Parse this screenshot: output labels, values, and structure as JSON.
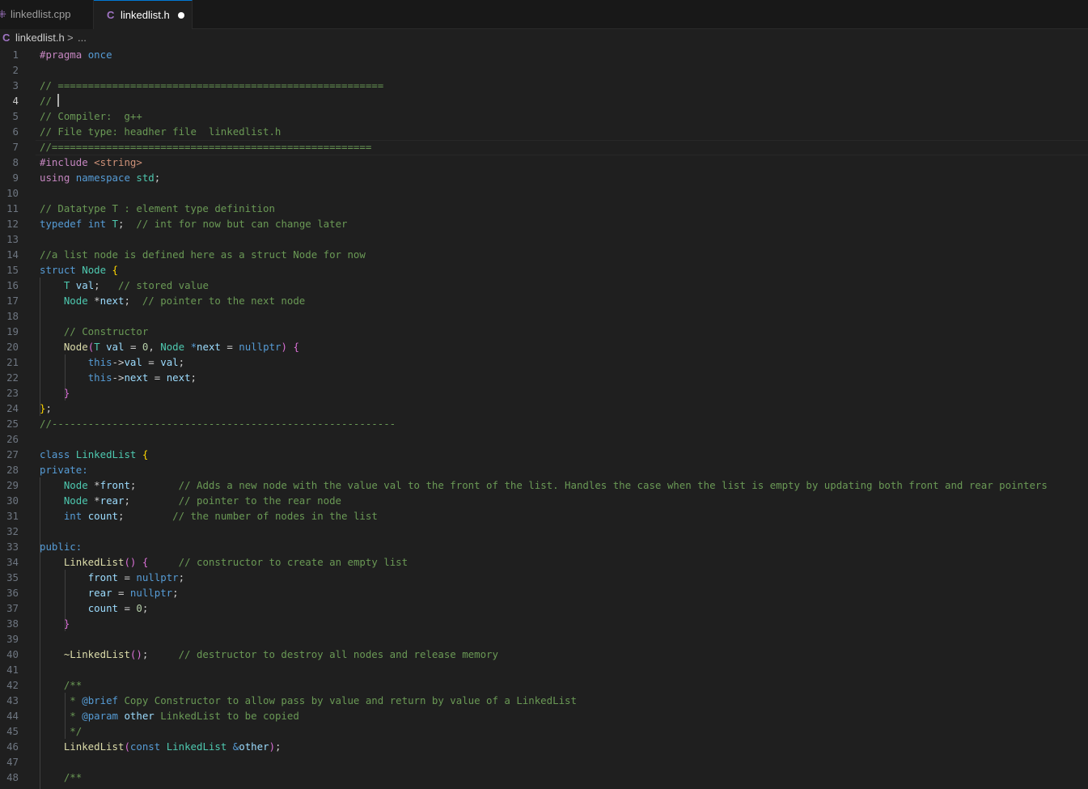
{
  "tabs": [
    {
      "label": "linkedlist.cpp",
      "icon": "cpp-file-icon",
      "active": false
    },
    {
      "label": "linkedlist.h",
      "icon": "c-header-file-icon",
      "active": true,
      "modified": true
    }
  ],
  "breadcrumb": {
    "icon": "C",
    "file": "linkedlist.h",
    "separator": ">",
    "more": "..."
  },
  "file_icon_letter": "C",
  "cursor_line": 4,
  "lines": [
    {
      "n": "1",
      "tokens": [
        [
          "#pragma",
          "t-ctl"
        ],
        [
          " ",
          ""
        ],
        [
          "once",
          "t-kw"
        ]
      ]
    },
    {
      "n": "2",
      "tokens": []
    },
    {
      "n": "3",
      "tokens": [
        [
          "// ======================================================",
          "t-c"
        ]
      ]
    },
    {
      "n": "4",
      "tokens": [
        [
          "// ",
          "t-c"
        ]
      ],
      "cursor": true
    },
    {
      "n": "5",
      "tokens": [
        [
          "// Compiler:  g++",
          "t-c"
        ]
      ]
    },
    {
      "n": "6",
      "tokens": [
        [
          "// File type: headher file  linkedlist.h",
          "t-c"
        ]
      ]
    },
    {
      "n": "7",
      "tokens": [
        [
          "//=====================================================",
          "t-c"
        ]
      ]
    },
    {
      "n": "8",
      "tokens": [
        [
          "#include",
          "t-ctl"
        ],
        [
          " ",
          ""
        ],
        [
          "<string>",
          "t-s"
        ]
      ]
    },
    {
      "n": "9",
      "tokens": [
        [
          "using",
          "t-ctl"
        ],
        [
          " ",
          ""
        ],
        [
          "namespace",
          "t-kw"
        ],
        [
          " ",
          ""
        ],
        [
          "std",
          "t-ty"
        ],
        [
          ";",
          ""
        ]
      ]
    },
    {
      "n": "10",
      "tokens": []
    },
    {
      "n": "11",
      "tokens": [
        [
          "// Datatype T : element type definition",
          "t-c"
        ]
      ]
    },
    {
      "n": "12",
      "tokens": [
        [
          "typedef",
          "t-kw"
        ],
        [
          " ",
          ""
        ],
        [
          "int",
          "t-kw"
        ],
        [
          " ",
          ""
        ],
        [
          "T",
          "t-ty"
        ],
        [
          ";  ",
          ""
        ],
        [
          "// int for now but can change later",
          "t-c"
        ]
      ]
    },
    {
      "n": "13",
      "tokens": []
    },
    {
      "n": "14",
      "tokens": [
        [
          "//a list node is defined here as a struct Node for now",
          "t-c"
        ]
      ]
    },
    {
      "n": "15",
      "tokens": [
        [
          "struct",
          "t-kw"
        ],
        [
          " ",
          ""
        ],
        [
          "Node",
          "t-ty"
        ],
        [
          " ",
          ""
        ],
        [
          "{",
          "t-b1"
        ]
      ]
    },
    {
      "n": "16",
      "tokens": [
        [
          "    ",
          ""
        ],
        [
          "T",
          "t-ty"
        ],
        [
          " ",
          ""
        ],
        [
          "val",
          "t-v"
        ],
        [
          ";   ",
          ""
        ],
        [
          "// stored value",
          "t-c"
        ]
      ]
    },
    {
      "n": "17",
      "tokens": [
        [
          "    ",
          ""
        ],
        [
          "Node",
          "t-ty"
        ],
        [
          " *",
          ""
        ],
        [
          "next",
          "t-v"
        ],
        [
          ";  ",
          ""
        ],
        [
          "// pointer to the next node",
          "t-c"
        ]
      ]
    },
    {
      "n": "18",
      "tokens": []
    },
    {
      "n": "19",
      "tokens": [
        [
          "    ",
          ""
        ],
        [
          "// Constructor",
          "t-c"
        ]
      ]
    },
    {
      "n": "20",
      "tokens": [
        [
          "    ",
          ""
        ],
        [
          "Node",
          "t-fn"
        ],
        [
          "(",
          "t-b2"
        ],
        [
          "T",
          "t-ty"
        ],
        [
          " ",
          ""
        ],
        [
          "val",
          "t-v"
        ],
        [
          " = ",
          ""
        ],
        [
          "0",
          "t-n"
        ],
        [
          ", ",
          ""
        ],
        [
          "Node",
          "t-ty"
        ],
        [
          " ",
          ""
        ],
        [
          "*",
          "t-kw"
        ],
        [
          "next",
          "t-v"
        ],
        [
          " = ",
          ""
        ],
        [
          "nullptr",
          "t-kw"
        ],
        [
          ")",
          "t-b2"
        ],
        [
          " ",
          ""
        ],
        [
          "{",
          "t-b2"
        ]
      ]
    },
    {
      "n": "21",
      "tokens": [
        [
          "        ",
          ""
        ],
        [
          "this",
          "t-kw"
        ],
        [
          "->",
          ""
        ],
        [
          "val",
          "t-v"
        ],
        [
          " = ",
          ""
        ],
        [
          "val",
          "t-v"
        ],
        [
          ";",
          ""
        ]
      ]
    },
    {
      "n": "22",
      "tokens": [
        [
          "        ",
          ""
        ],
        [
          "this",
          "t-kw"
        ],
        [
          "->",
          ""
        ],
        [
          "next",
          "t-v"
        ],
        [
          " = ",
          ""
        ],
        [
          "next",
          "t-v"
        ],
        [
          ";",
          ""
        ]
      ]
    },
    {
      "n": "23",
      "tokens": [
        [
          "    ",
          ""
        ],
        [
          "}",
          "t-b2"
        ]
      ]
    },
    {
      "n": "24",
      "tokens": [
        [
          "}",
          "t-b1"
        ],
        [
          ";",
          ""
        ]
      ]
    },
    {
      "n": "25",
      "tokens": [
        [
          "//---------------------------------------------------------",
          "t-c"
        ]
      ]
    },
    {
      "n": "26",
      "tokens": []
    },
    {
      "n": "27",
      "tokens": [
        [
          "class",
          "t-kw"
        ],
        [
          " ",
          ""
        ],
        [
          "LinkedList",
          "t-ty"
        ],
        [
          " ",
          ""
        ],
        [
          "{",
          "t-b1"
        ]
      ]
    },
    {
      "n": "28",
      "tokens": [
        [
          "private:",
          "t-kw"
        ]
      ]
    },
    {
      "n": "29",
      "tokens": [
        [
          "    ",
          ""
        ],
        [
          "Node",
          "t-ty"
        ],
        [
          " *",
          ""
        ],
        [
          "front",
          "t-v"
        ],
        [
          ";       ",
          ""
        ],
        [
          "// Adds a new node with the value val to the front of the list. Handles the case when the list is empty by updating both front and rear pointers",
          "t-c"
        ]
      ]
    },
    {
      "n": "30",
      "tokens": [
        [
          "    ",
          ""
        ],
        [
          "Node",
          "t-ty"
        ],
        [
          " *",
          ""
        ],
        [
          "rear",
          "t-v"
        ],
        [
          ";        ",
          ""
        ],
        [
          "// pointer to the rear node",
          "t-c"
        ]
      ]
    },
    {
      "n": "31",
      "tokens": [
        [
          "    ",
          ""
        ],
        [
          "int",
          "t-kw"
        ],
        [
          " ",
          ""
        ],
        [
          "count",
          "t-v"
        ],
        [
          ";        ",
          ""
        ],
        [
          "// the number of nodes in the list",
          "t-c"
        ]
      ]
    },
    {
      "n": "32",
      "tokens": []
    },
    {
      "n": "33",
      "tokens": [
        [
          "public:",
          "t-kw"
        ]
      ]
    },
    {
      "n": "34",
      "tokens": [
        [
          "    ",
          ""
        ],
        [
          "LinkedList",
          "t-fn"
        ],
        [
          "()",
          "t-b2"
        ],
        [
          " ",
          ""
        ],
        [
          "{",
          "t-b2"
        ],
        [
          "     ",
          ""
        ],
        [
          "// constructor to create an empty list",
          "t-c"
        ]
      ]
    },
    {
      "n": "35",
      "tokens": [
        [
          "        ",
          ""
        ],
        [
          "front",
          "t-v"
        ],
        [
          " = ",
          ""
        ],
        [
          "nullptr",
          "t-kw"
        ],
        [
          ";",
          ""
        ]
      ]
    },
    {
      "n": "36",
      "tokens": [
        [
          "        ",
          ""
        ],
        [
          "rear",
          "t-v"
        ],
        [
          " = ",
          ""
        ],
        [
          "nullptr",
          "t-kw"
        ],
        [
          ";",
          ""
        ]
      ]
    },
    {
      "n": "37",
      "tokens": [
        [
          "        ",
          ""
        ],
        [
          "count",
          "t-v"
        ],
        [
          " = ",
          ""
        ],
        [
          "0",
          "t-n"
        ],
        [
          ";",
          ""
        ]
      ]
    },
    {
      "n": "38",
      "tokens": [
        [
          "    ",
          ""
        ],
        [
          "}",
          "t-b2"
        ]
      ]
    },
    {
      "n": "39",
      "tokens": []
    },
    {
      "n": "40",
      "tokens": [
        [
          "    ",
          ""
        ],
        [
          "~LinkedList",
          "t-fn"
        ],
        [
          "()",
          "t-b2"
        ],
        [
          ";     ",
          ""
        ],
        [
          "// destructor to destroy all nodes and release memory",
          "t-c"
        ]
      ]
    },
    {
      "n": "41",
      "tokens": []
    },
    {
      "n": "42",
      "tokens": [
        [
          "    ",
          ""
        ],
        [
          "/**",
          "t-c"
        ]
      ]
    },
    {
      "n": "43",
      "tokens": [
        [
          "    ",
          ""
        ],
        [
          " * ",
          "t-c"
        ],
        [
          "@brief",
          "t-kw"
        ],
        [
          " Copy Constructor to allow pass by value and return by value of a LinkedList",
          "t-c"
        ]
      ]
    },
    {
      "n": "44",
      "tokens": [
        [
          "    ",
          ""
        ],
        [
          " * ",
          "t-c"
        ],
        [
          "@param",
          "t-kw"
        ],
        [
          " ",
          ""
        ],
        [
          "other",
          "t-v"
        ],
        [
          " LinkedList to be copied",
          "t-c"
        ]
      ]
    },
    {
      "n": "45",
      "tokens": [
        [
          "    ",
          ""
        ],
        [
          " */",
          "t-c"
        ]
      ]
    },
    {
      "n": "46",
      "tokens": [
        [
          "    ",
          ""
        ],
        [
          "LinkedList",
          "t-fn"
        ],
        [
          "(",
          "t-b2"
        ],
        [
          "const",
          "t-kw"
        ],
        [
          " ",
          ""
        ],
        [
          "LinkedList",
          "t-ty"
        ],
        [
          " ",
          ""
        ],
        [
          "&",
          "t-kw"
        ],
        [
          "other",
          "t-v"
        ],
        [
          ")",
          "t-b2"
        ],
        [
          ";",
          ""
        ]
      ]
    },
    {
      "n": "47",
      "tokens": []
    },
    {
      "n": "48",
      "tokens": [
        [
          "    ",
          ""
        ],
        [
          "/**",
          "t-c"
        ]
      ]
    }
  ]
}
